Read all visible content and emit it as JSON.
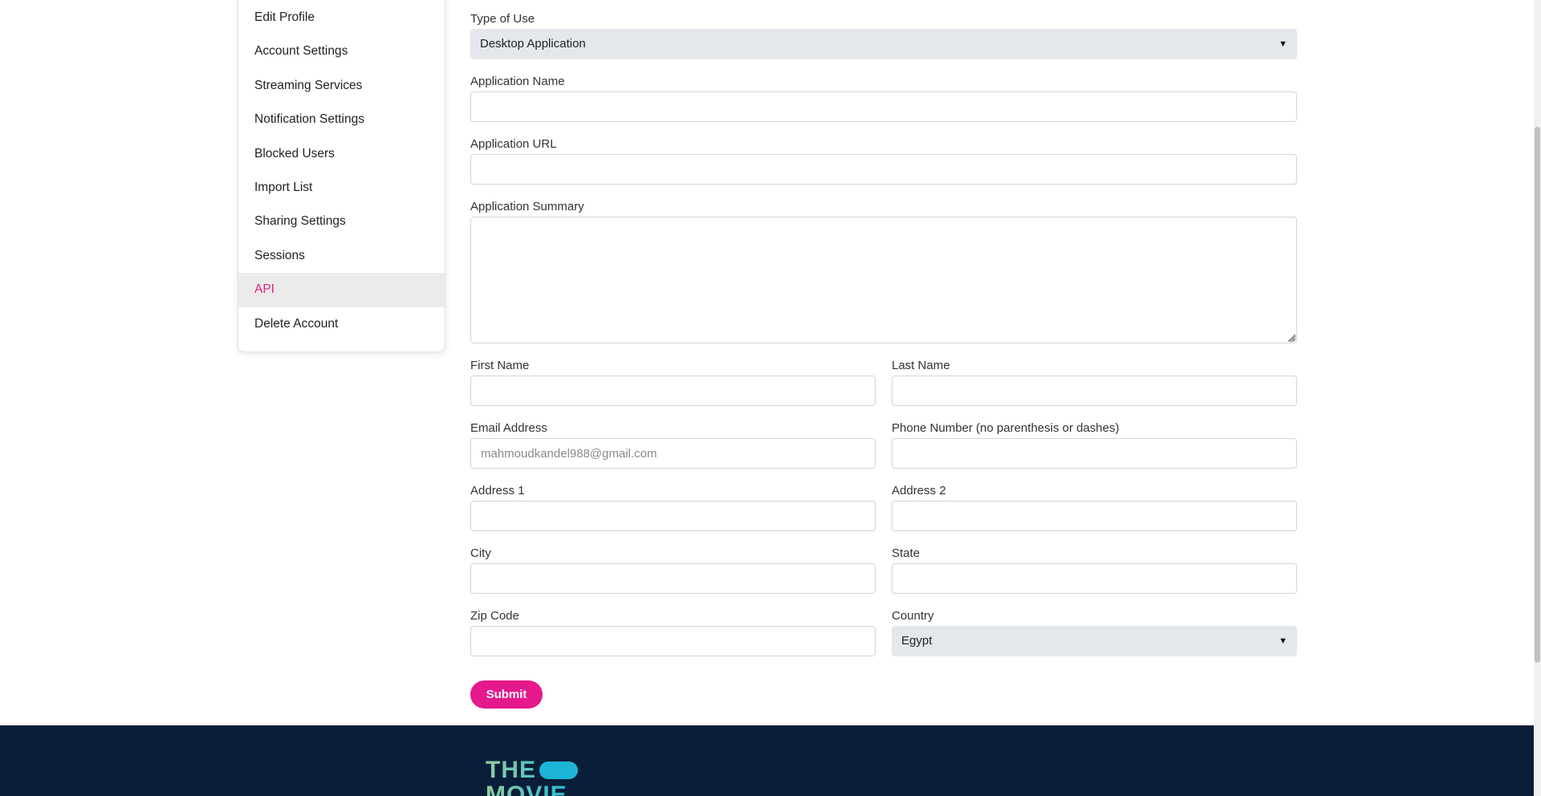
{
  "sidebar": {
    "items": [
      {
        "label": "Edit Profile"
      },
      {
        "label": "Account Settings"
      },
      {
        "label": "Streaming Services"
      },
      {
        "label": "Notification Settings"
      },
      {
        "label": "Blocked Users"
      },
      {
        "label": "Import List"
      },
      {
        "label": "Sharing Settings"
      },
      {
        "label": "Sessions"
      },
      {
        "label": "API"
      },
      {
        "label": "Delete Account"
      }
    ],
    "active": "API"
  },
  "form": {
    "type_of_use": {
      "label": "Type of Use",
      "value": "Desktop Application"
    },
    "application_name": {
      "label": "Application Name",
      "value": ""
    },
    "application_url": {
      "label": "Application URL",
      "value": ""
    },
    "application_summary": {
      "label": "Application Summary",
      "value": ""
    },
    "first_name": {
      "label": "First Name",
      "value": ""
    },
    "last_name": {
      "label": "Last Name",
      "value": ""
    },
    "email": {
      "label": "Email Address",
      "placeholder": "mahmoudkandel988@gmail.com",
      "value": ""
    },
    "phone": {
      "label": "Phone Number (no parenthesis or dashes)",
      "value": ""
    },
    "address1": {
      "label": "Address 1",
      "value": ""
    },
    "address2": {
      "label": "Address 2",
      "value": ""
    },
    "city": {
      "label": "City",
      "value": ""
    },
    "state": {
      "label": "State",
      "value": ""
    },
    "zip": {
      "label": "Zip Code",
      "value": ""
    },
    "country": {
      "label": "Country",
      "value": "Egypt"
    },
    "submit_label": "Submit"
  },
  "footer": {
    "logo_line1": "THE",
    "logo_line2": "MOVIE"
  },
  "colors": {
    "accent": "#e5188c",
    "footer_bg": "#0a1e39",
    "select_bg": "#e4e7eb"
  }
}
